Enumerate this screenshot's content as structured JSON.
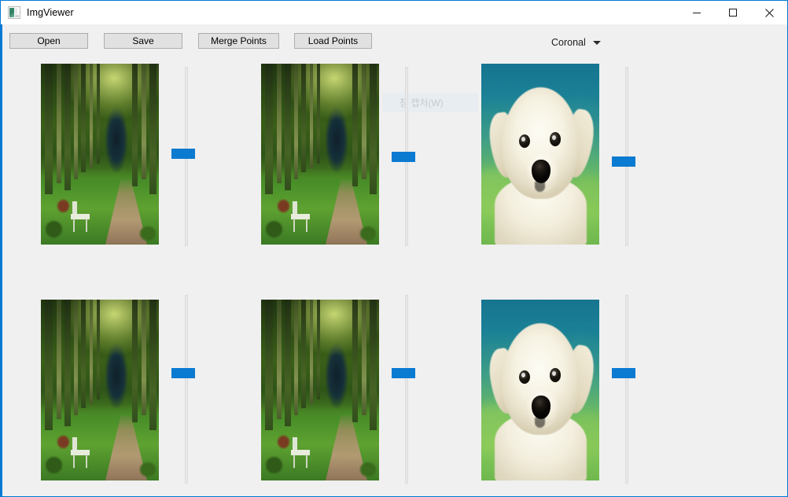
{
  "window": {
    "title": "ImgViewer",
    "icon": "image-window-icon",
    "controls": {
      "minimize": "minimize-icon",
      "maximize": "maximize-icon",
      "close": "close-icon"
    },
    "accent_color": "#0078d7",
    "client_background": "#f0f0f0"
  },
  "toolbar": {
    "open_label": "Open",
    "save_label": "Save",
    "merge_points_label": "Merge Points",
    "load_points_label": "Load Points"
  },
  "view_selector": {
    "selected": "Coronal",
    "arrow_icon": "chevron-down-icon",
    "options": [
      "Coronal"
    ]
  },
  "overlay": {
    "ghost_text": "창 캡처(W)",
    "background": "#e6ecf2"
  },
  "panes": [
    {
      "id": "pane-r1c1",
      "image": "forest-path",
      "slider_value": 52
    },
    {
      "id": "pane-r1c2",
      "image": "forest-path",
      "slider_value": 50
    },
    {
      "id": "pane-r1c3",
      "image": "puppy",
      "slider_value": 47
    },
    {
      "id": "pane-r2c1",
      "image": "forest-path",
      "slider_value": 58
    },
    {
      "id": "pane-r2c2",
      "image": "forest-path",
      "slider_value": 58
    },
    {
      "id": "pane-r2c3",
      "image": "puppy",
      "slider_value": 58
    }
  ],
  "slider_colors": {
    "thumb": "#0b7ad1",
    "track": "#e8e8e8"
  }
}
